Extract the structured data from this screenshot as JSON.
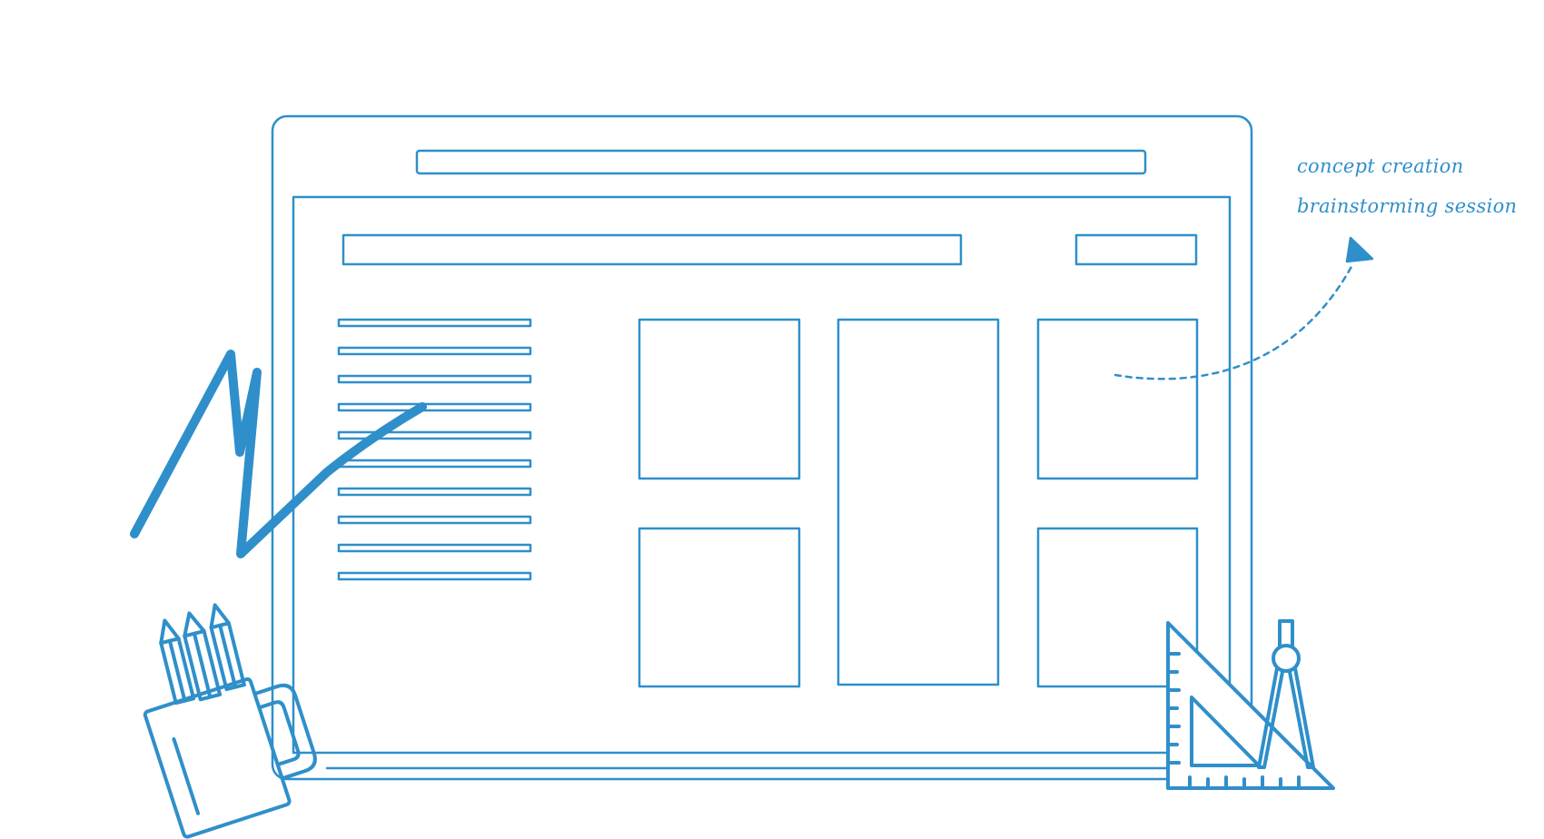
{
  "colors": {
    "line": "#2f8fca",
    "background": "#ffffff"
  },
  "annotation": {
    "line1": "concept creation",
    "line2": "brainstorming session"
  },
  "icons": {
    "scribble": "scribble-doodle-icon",
    "pencil_cup": "pencil-cup-icon",
    "ruler_compass": "ruler-triangle-compass-icon",
    "arrow": "dashed-curved-arrow-icon"
  }
}
